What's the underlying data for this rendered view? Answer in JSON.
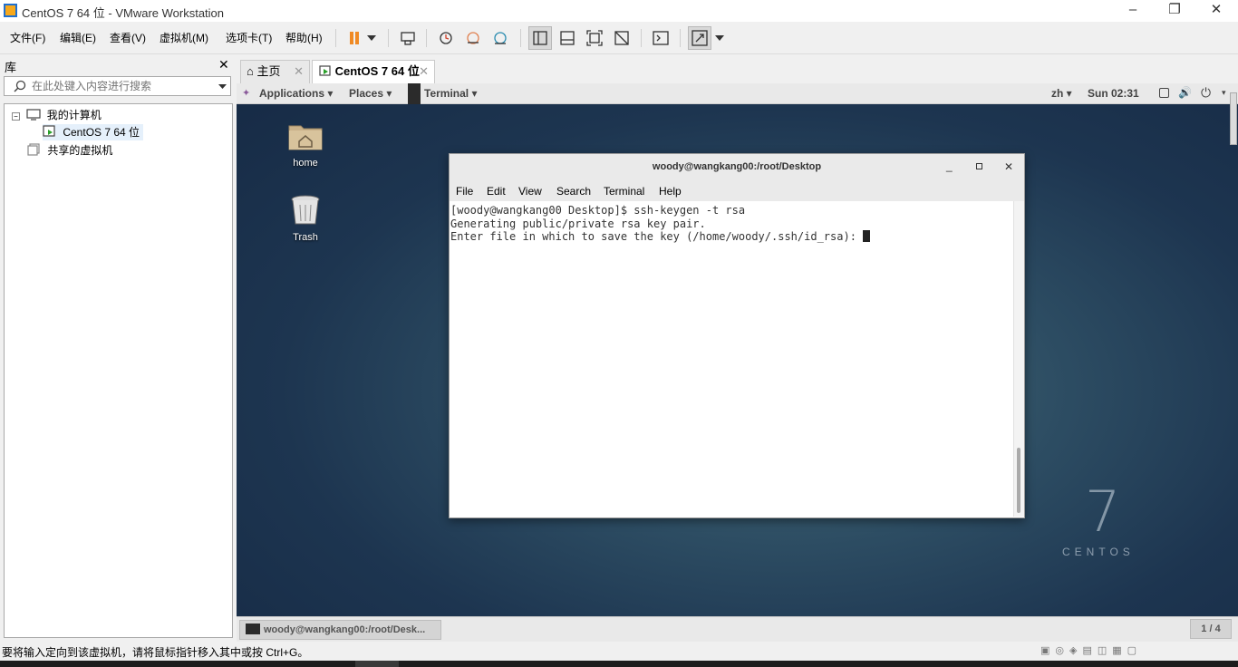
{
  "window": {
    "title": "CentOS 7 64 位 - VMware Workstation",
    "minimize_icon": "minimize-icon",
    "maximize_icon": "maximize-icon",
    "close_icon": "close-icon"
  },
  "menus": [
    "文件(F)",
    "编辑(E)",
    "查看(V)",
    "虚拟机(M)",
    "选项卡(T)",
    "帮助(H)"
  ],
  "library": {
    "title": "库",
    "search_placeholder": "在此处键入内容进行搜索",
    "tree": {
      "my_computer": "我的计算机",
      "vm": "CentOS 7 64 位",
      "shared": "共享的虚拟机"
    }
  },
  "tabs": {
    "home": "主页",
    "vm": "CentOS 7 64 位"
  },
  "guest": {
    "topbar": {
      "applications": "Applications",
      "places": "Places",
      "terminal": "Terminal",
      "lang": "zh",
      "clock": "Sun 02:31"
    },
    "desktop": {
      "home_label": "home",
      "trash_label": "Trash",
      "centos_number": "7",
      "centos_word": "CENTOS"
    },
    "terminal": {
      "title": "woody@wangkang00:/root/Desktop",
      "menus": [
        "File",
        "Edit",
        "View",
        "Search",
        "Terminal",
        "Help"
      ],
      "lines": [
        "[woody@wangkang00 Desktop]$ ssh-keygen -t rsa",
        "Generating public/private rsa key pair.",
        "Enter file in which to save the key (/home/woody/.ssh/id_rsa): "
      ]
    },
    "bottombar": {
      "task": "woody@wangkang00:/root/Desk...",
      "workspace": "1 / 4"
    }
  },
  "status_text": "要将输入定向到该虚拟机，请将鼠标指针移入其中或按 Ctrl+G。",
  "colors": {
    "accent": "#1e6fd0",
    "pause": "#f08a24",
    "desktop": "#1d3550"
  }
}
